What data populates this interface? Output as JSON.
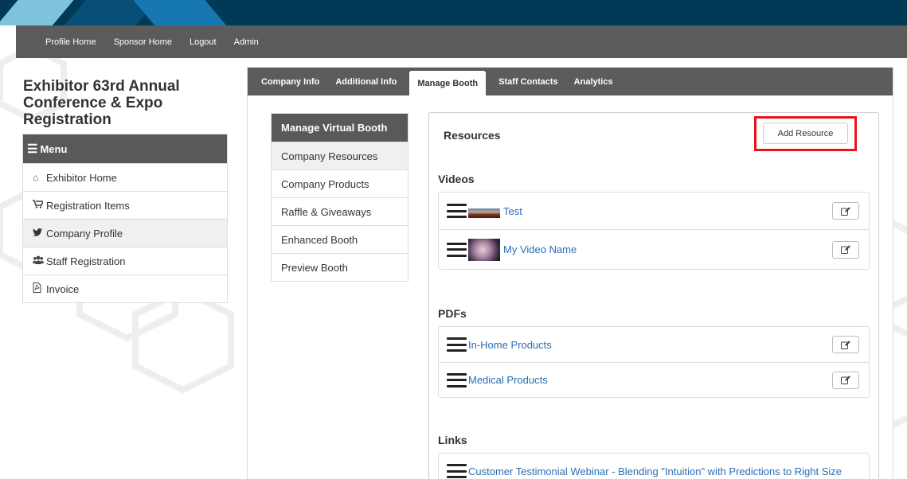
{
  "colors": {
    "banner": "#003a57",
    "nav_bg": "#5b5b5b",
    "link": "#2a6fb3",
    "highlight": "#e8121c"
  },
  "topnav": {
    "items": [
      "Profile Home",
      "Sponsor Home",
      "Logout",
      "Admin"
    ]
  },
  "registration": {
    "title": "Exhibitor 63rd Annual Conference & Expo Registration"
  },
  "menu": {
    "title": "Menu",
    "items": [
      {
        "label": "Exhibitor Home",
        "icon": "home-icon"
      },
      {
        "label": "Registration Items",
        "icon": "cart-icon"
      },
      {
        "label": "Company Profile",
        "icon": "twitter-icon",
        "active": true
      },
      {
        "label": "Staff Registration",
        "icon": "users-icon"
      },
      {
        "label": "Invoice",
        "icon": "pdf-icon"
      }
    ]
  },
  "tabs": [
    {
      "label": "Company Info"
    },
    {
      "label": "Additional Info"
    },
    {
      "label": "Manage Booth",
      "active": true
    },
    {
      "label": "Staff Contacts"
    },
    {
      "label": "Analytics"
    }
  ],
  "virtual_booth": {
    "title": "Manage Virtual Booth",
    "items": [
      "Company Resources",
      "Company Products",
      "Raffle & Giveaways",
      "Enhanced Booth",
      "Preview Booth"
    ]
  },
  "resources": {
    "title": "Resources",
    "add_button": "Add Resource",
    "videos_label": "Videos",
    "videos": [
      "Test",
      "My Video Name"
    ],
    "pdfs_label": "PDFs",
    "pdfs": [
      "In-Home Products",
      "Medical Products"
    ],
    "links_label": "Links",
    "links": [
      "Customer Testimonial Webinar - Blending \"Intuition\" with Predictions to Right Size"
    ]
  }
}
